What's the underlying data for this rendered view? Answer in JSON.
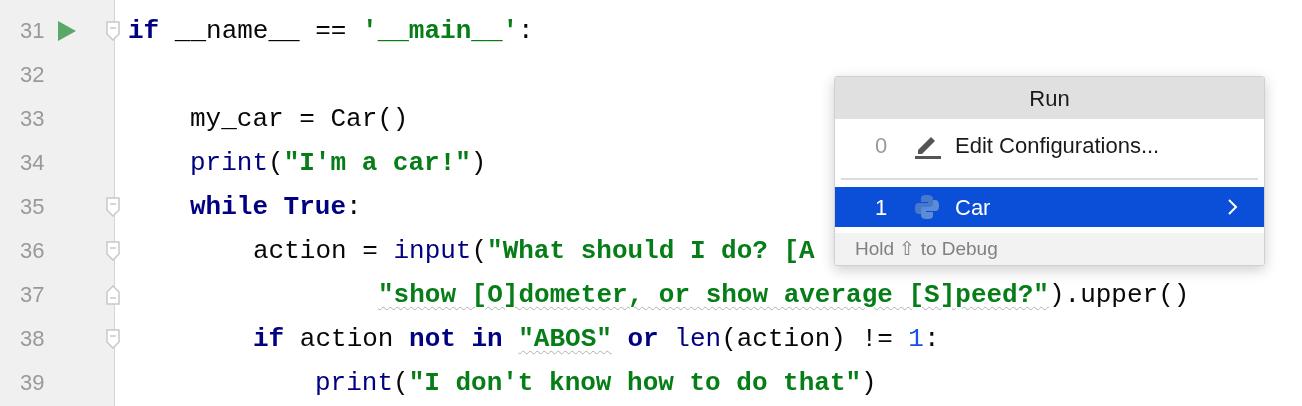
{
  "editor": {
    "lines": [
      {
        "number": "31",
        "runnable": true,
        "fold_start": true,
        "fold_end": false,
        "tokens": [
          {
            "kind": "keyword",
            "text": "if"
          },
          {
            "kind": "plain",
            "text": " __name__ == "
          },
          {
            "kind": "string",
            "text": "'__main__'"
          },
          {
            "kind": "plain",
            "text": ":"
          }
        ],
        "children": [
          {
            "number": "32",
            "runnable": false,
            "fold_start": false,
            "fold_end": false
          },
          {
            "number": "33",
            "runnable": false,
            "fold_start": false,
            "fold_end": false,
            "tokens": [
              {
                "kind": "plain",
                "text": "my_car = Car()"
              }
            ]
          },
          {
            "number": "34",
            "runnable": false,
            "fold_start": false,
            "fold_end": false,
            "tokens": [
              {
                "kind": "builtin",
                "text": "print"
              },
              {
                "kind": "plain",
                "text": "("
              },
              {
                "kind": "string",
                "text": "\"I'm a car!\""
              },
              {
                "kind": "plain",
                "text": ")"
              }
            ]
          },
          {
            "number": "35",
            "runnable": false,
            "fold_start": true,
            "fold_end": false,
            "tokens": [
              {
                "kind": "keyword",
                "text": "while True"
              },
              {
                "kind": "plain",
                "text": ":"
              }
            ],
            "children": [
              {
                "number": "36",
                "runnable": false,
                "fold_start": true,
                "fold_end": false,
                "tokens": [
                  {
                    "kind": "plain",
                    "text": "action = "
                  },
                  {
                    "kind": "builtin",
                    "text": "input"
                  },
                  {
                    "kind": "plain",
                    "text": "("
                  },
                  {
                    "kind": "string",
                    "text": "\"What should I do? [A"
                  }
                ],
                "children": [
                  {
                    "number": "37",
                    "kind": "continuation",
                    "runnable": false,
                    "fold_start": false,
                    "fold_end": true,
                    "tokens": [
                      {
                        "kind": "string",
                        "text": "\"show [O]dometer, or show average [S]peed?\"",
                        "warning": true
                      },
                      {
                        "kind": "plain",
                        "text": ").upper()"
                      }
                    ]
                  }
                ]
              },
              {
                "number": "38",
                "runnable": false,
                "fold_start": true,
                "fold_end": false,
                "tokens": [
                  {
                    "kind": "keyword",
                    "text": "if"
                  },
                  {
                    "kind": "plain",
                    "text": " action "
                  },
                  {
                    "kind": "keyword",
                    "text": "not in "
                  },
                  {
                    "kind": "string",
                    "text": "\"ABOS\"",
                    "warning": true
                  },
                  {
                    "kind": "keyword",
                    "text": " or "
                  },
                  {
                    "kind": "builtin",
                    "text": "len"
                  },
                  {
                    "kind": "plain",
                    "text": "(action) != "
                  },
                  {
                    "kind": "number",
                    "text": "1"
                  },
                  {
                    "kind": "plain",
                    "text": ":"
                  }
                ],
                "children": [
                  {
                    "number": "39",
                    "runnable": false,
                    "fold_start": false,
                    "fold_end": false,
                    "tokens": [
                      {
                        "kind": "builtin",
                        "text": "print"
                      },
                      {
                        "kind": "plain",
                        "text": "("
                      },
                      {
                        "kind": "string",
                        "text": "\"I don't know how to do that\""
                      },
                      {
                        "kind": "plain",
                        "text": ")"
                      }
                    ]
                  }
                ]
              }
            ]
          }
        ]
      }
    ]
  },
  "popup": {
    "title": "Run",
    "items": [
      {
        "kind": "edit",
        "index": "0",
        "label": "Edit Configurations...",
        "selected": false,
        "submenu": false
      },
      {
        "kind": "python",
        "index": "1",
        "label": "Car",
        "selected": true,
        "submenu": true
      }
    ],
    "footer": "Hold ⇧ to Debug"
  }
}
